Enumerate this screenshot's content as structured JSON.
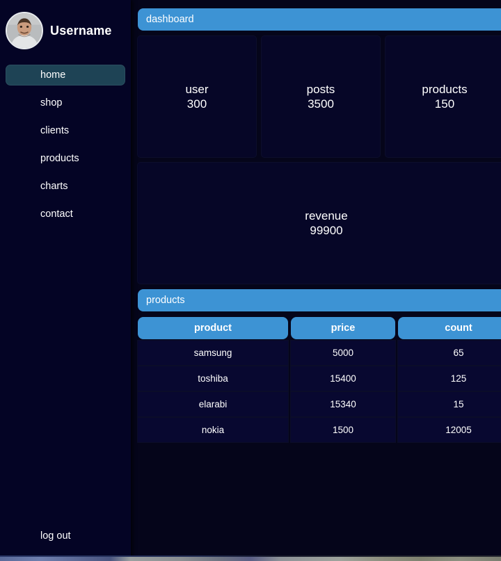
{
  "sidebar": {
    "avatar_icon": "user-photo-avatar",
    "username": "Username",
    "items": [
      {
        "label": "home",
        "active": true
      },
      {
        "label": "shop",
        "active": false
      },
      {
        "label": "clients",
        "active": false
      },
      {
        "label": "products",
        "active": false
      },
      {
        "label": "charts",
        "active": false
      },
      {
        "label": "contact",
        "active": false
      }
    ],
    "logout_label": "log out"
  },
  "main": {
    "dashboard_title": "dashboard",
    "stats": [
      {
        "label": "user",
        "value": "300"
      },
      {
        "label": "posts",
        "value": "3500"
      },
      {
        "label": "products",
        "value": "150"
      }
    ],
    "revenue": {
      "label": "revenue",
      "value": "99900"
    },
    "products_panel": {
      "title": "products",
      "columns": [
        "product",
        "price",
        "count"
      ],
      "rows": [
        {
          "product": "samsung",
          "price": "5000",
          "count": "65"
        },
        {
          "product": "toshiba",
          "price": "15400",
          "count": "125"
        },
        {
          "product": "elarabi",
          "price": "15340",
          "count": "15"
        },
        {
          "product": "nokia",
          "price": "1500",
          "count": "12005"
        }
      ]
    }
  },
  "colors": {
    "accent_blue": "#3d93d4",
    "sidebar_bg": "#040425",
    "content_bg": "#05051a",
    "card_bg": "#060627",
    "row_bg": "#080830",
    "active_nav": "#1e4355",
    "text": "#ffffff"
  }
}
